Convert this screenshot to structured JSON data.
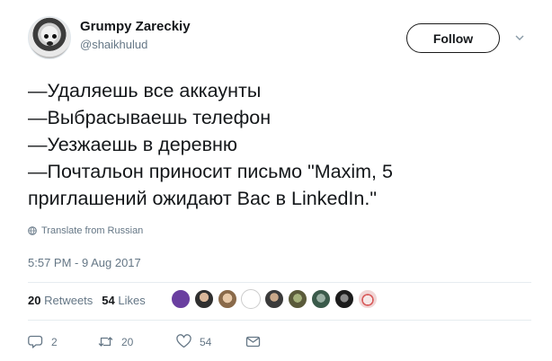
{
  "user": {
    "display_name": "Grumpy Zareckiy",
    "handle": "@shaikhulud"
  },
  "follow_label": "Follow",
  "tweet": {
    "lines": [
      "—Удаляешь все аккаунты",
      "—Выбрасываешь телефон",
      "—Уезжаешь в деревню",
      "—Почтальон приносит письмо \"Maxim, 5",
      "приглашений ожидают Вас в LinkedIn.\""
    ]
  },
  "translate_label": "Translate from Russian",
  "timestamp": "5:57 PM - 9 Aug 2017",
  "stats": {
    "retweets_count": "20",
    "retweets_label": "Retweets",
    "likes_count": "54",
    "likes_label": "Likes"
  },
  "likers": [
    {
      "icon": "pixel-story-avatar",
      "color": "#6a3fa0"
    },
    {
      "icon": "person-avatar",
      "color": "#2f2f2f"
    },
    {
      "icon": "person-avatar",
      "color": "#b48a6a"
    },
    {
      "icon": "drawing-avatar",
      "color": "#ffffff"
    },
    {
      "icon": "person-avatar",
      "color": "#3a3a3a"
    },
    {
      "icon": "person-avatar",
      "color": "#7a6a3a"
    },
    {
      "icon": "person-avatar",
      "color": "#5a7a6a"
    },
    {
      "icon": "person-avatar",
      "color": "#2c2c2c"
    },
    {
      "icon": "person-avatar",
      "color": "#f0d6d6"
    }
  ],
  "actions": {
    "replies": "2",
    "retweets": "20",
    "likes": "54"
  },
  "colors": {
    "text": "#14171a",
    "secondary": "#657786",
    "divider": "#e6ecf0"
  }
}
